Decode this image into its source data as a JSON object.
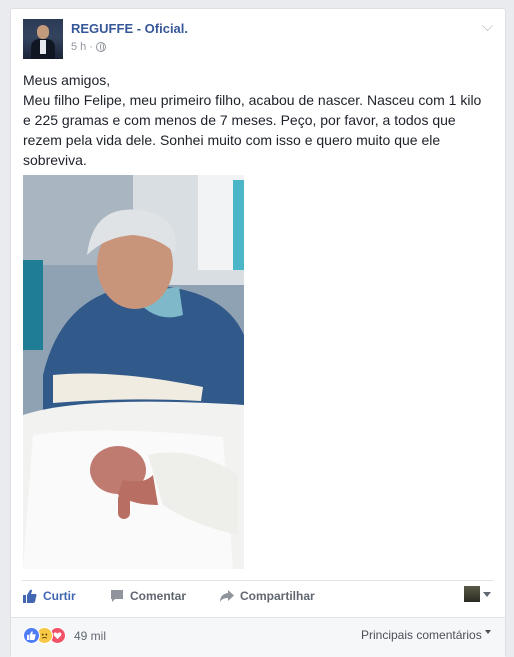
{
  "post": {
    "author": "REGUFFE - Oficial.",
    "timestamp": "5 h",
    "separator": "·",
    "privacy_icon": "globe-icon",
    "menu_icon": "chevron-down-icon",
    "text_lines": [
      "Meus amigos,",
      "Meu filho Felipe, meu primeiro filho, acabou de nascer. Nasceu com 1 kilo e 225 gramas e com menos de 7 meses. Peço, por favor, a todos que rezem pela vida dele. Sonhei muito com isso e quero muito que ele sobreviva."
    ]
  },
  "actions": {
    "like_label": "Curtir",
    "comment_label": "Comentar",
    "share_label": "Compartilhar"
  },
  "footer": {
    "reactions": [
      "like",
      "sad",
      "love"
    ],
    "reaction_count": "49 mil",
    "sort_label": "Principais comentários"
  },
  "colors": {
    "link": "#365899",
    "like_blue": "#4267b2",
    "muted": "#90949c",
    "page_bg": "#e9ebee"
  }
}
